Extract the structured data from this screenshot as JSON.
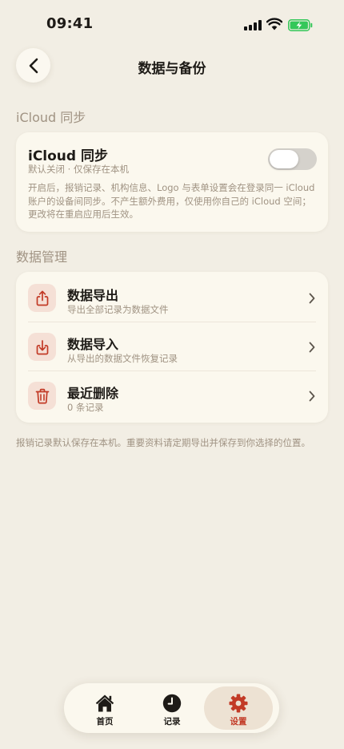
{
  "status_bar": {
    "time": "09:41"
  },
  "header": {
    "title": "数据与备份"
  },
  "icloud_section": {
    "label": "iCloud 同步",
    "title": "iCloud 同步",
    "subtitle": "默认关闭 · 仅保存在本机",
    "toggle_on": false,
    "description": "开启后，报销记录、机构信息、Logo 与表单设置会在登录同一 iCloud 账户的设备间同步。不产生额外费用，仅使用你自己的 iCloud 空间；更改将在重启应用后生效。"
  },
  "data_section": {
    "label": "数据管理",
    "items": [
      {
        "title": "数据导出",
        "subtitle": "导出全部记录为数据文件",
        "icon": "share-export-icon"
      },
      {
        "title": "数据导入",
        "subtitle": "从导出的数据文件恢复记录",
        "icon": "download-import-icon"
      },
      {
        "title": "最近删除",
        "subtitle": "0 条记录",
        "icon": "trash-icon"
      }
    ]
  },
  "footer_note": "报销记录默认保存在本机。重要资料请定期导出并保存到你选择的位置。",
  "tab_bar": {
    "tabs": [
      {
        "label": "首页",
        "icon": "home-icon",
        "active": false
      },
      {
        "label": "记录",
        "icon": "clock-icon",
        "active": false
      },
      {
        "label": "设置",
        "icon": "gear-icon",
        "active": true
      }
    ]
  },
  "colors": {
    "background": "#F2EEE4",
    "card": "#FBF8EE",
    "accent": "#C23A26",
    "icon_tint_bg": "#F5E0D6",
    "muted_text": "#A09383",
    "active_tab_bg": "#EDE2D3"
  }
}
